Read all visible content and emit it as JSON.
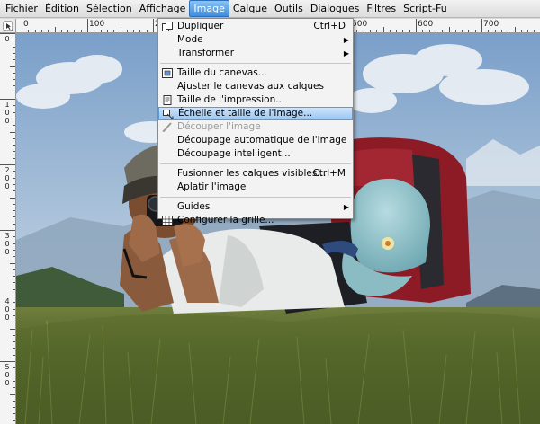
{
  "menubar": {
    "items": [
      "Fichier",
      "Édition",
      "Sélection",
      "Affichage",
      "Image",
      "Calque",
      "Outils",
      "Dialogues",
      "Filtres",
      "Script-Fu"
    ],
    "active_index": 4
  },
  "ruler": {
    "h_labels": [
      "0",
      "100",
      "200",
      "300",
      "400",
      "500",
      "600",
      "700"
    ],
    "v_labels": [
      "0",
      "100",
      "200",
      "300",
      "400",
      "500"
    ]
  },
  "image_menu": {
    "items": [
      {
        "label": "Dupliquer",
        "shortcut": "Ctrl+D",
        "icon": "duplicate-icon"
      },
      {
        "label": "Mode",
        "submenu": true
      },
      {
        "label": "Transformer",
        "submenu": true
      },
      {
        "separator": true
      },
      {
        "label": "Taille du canevas...",
        "icon": "canvas-size-icon"
      },
      {
        "label": "Ajuster le canevas aux calques"
      },
      {
        "label": "Taille de l'impression...",
        "icon": "print-size-icon"
      },
      {
        "label": "Échelle et taille de l'image...",
        "icon": "scale-image-icon",
        "highlight": true
      },
      {
        "label": "Découper l'image",
        "icon": "crop-icon",
        "disabled": true
      },
      {
        "label": "Découpage automatique de l'image"
      },
      {
        "label": "Découpage intelligent..."
      },
      {
        "separator": true
      },
      {
        "label": "Fusionner les calques visibles...",
        "shortcut": "Ctrl+M"
      },
      {
        "label": "Aplatir l'image"
      },
      {
        "separator": true
      },
      {
        "label": "Guides",
        "submenu": true
      },
      {
        "label": "Configurer la grille...",
        "icon": "grid-icon"
      }
    ]
  },
  "colors": {
    "menu_highlight": "#98c6f2",
    "menubar_active": "#3d8ee0"
  }
}
